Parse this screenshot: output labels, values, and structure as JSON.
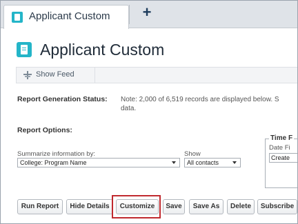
{
  "tab": {
    "label": "Applicant Custom",
    "add_symbol": "+"
  },
  "page": {
    "title": "Applicant Custom"
  },
  "feed": {
    "show_feed_label": "Show Feed"
  },
  "status": {
    "label": "Report Generation Status:",
    "text": "Note: 2,000 of 6,519 records are displayed below. S\ndata."
  },
  "options": {
    "label": "Report Options:",
    "summarize_label": "Summarize information by:",
    "summarize_value": "College: Program Name",
    "show_label": "Show",
    "show_value": "All contacts"
  },
  "time_frame": {
    "legend": "Time F",
    "date_field_label": "Date Fi",
    "date_field_value": "Create"
  },
  "buttons": {
    "run_report": "Run Report",
    "hide_details": "Hide Details",
    "customize": "Customize",
    "save": "Save",
    "save_as": "Save As",
    "delete": "Delete",
    "subscribe": "Subscribe"
  },
  "colors": {
    "accent": "#24b5c8",
    "highlight": "#c0292e"
  },
  "icons": {
    "tab": "report-icon",
    "add": "plus-icon",
    "page": "report-icon",
    "feed": "feed-icon",
    "dropdown": "chevron-down-icon"
  }
}
